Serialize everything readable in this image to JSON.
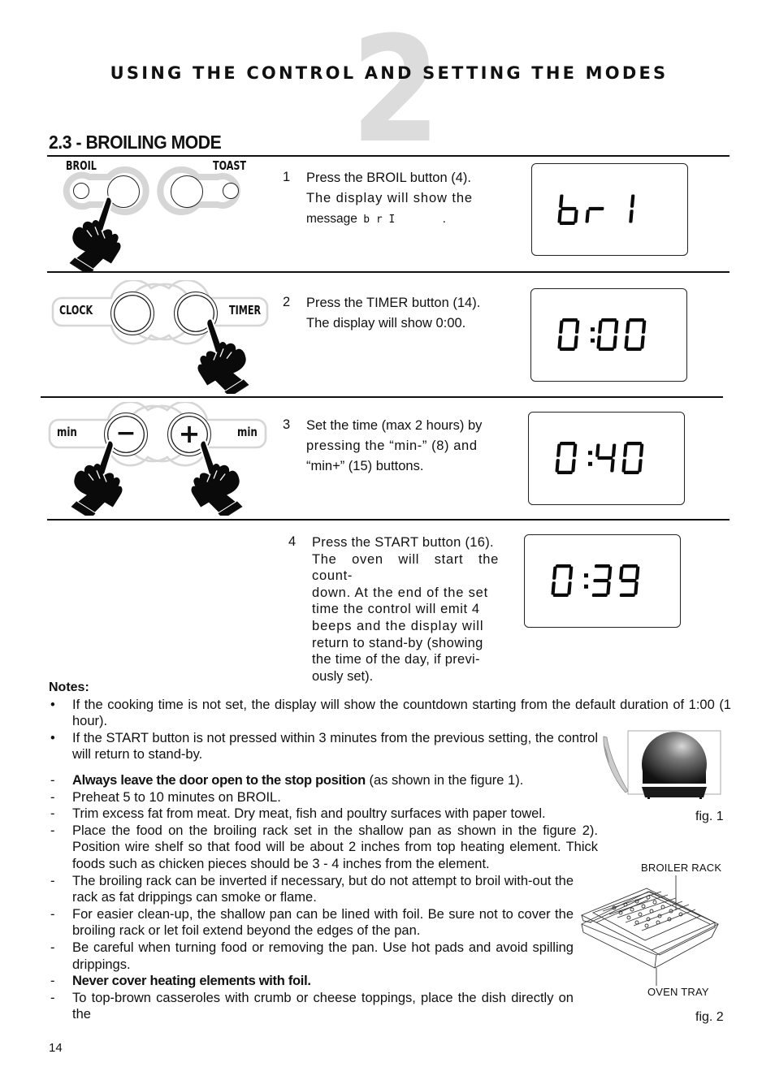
{
  "header": {
    "chapter_number": "2",
    "chapter_title": "USING THE CONTROL AND SETTING THE MODES",
    "section_title": "2.3 - BROILING MODE"
  },
  "steps": [
    {
      "number": "1",
      "text_lines": [
        "Press the BROIL button (4).",
        "The display will show the",
        "message"
      ],
      "inline_message": "b r I",
      "trailing": ".",
      "panel": {
        "left_label": "BROIL",
        "right_label": "TOAST",
        "pressed": "BROIL"
      },
      "display": "brI"
    },
    {
      "number": "2",
      "text_lines": [
        "Press the TIMER button (14).",
        "The display will show 0:00."
      ],
      "panel": {
        "left_label": "CLOCK",
        "right_label": "TIMER",
        "pressed": "TIMER"
      },
      "display": "0:00"
    },
    {
      "number": "3",
      "text_lines": [
        "Set the time (max 2 hours) by",
        "pressing the “min-” (8) and",
        "“min+” (15) buttons."
      ],
      "panel": {
        "left_label": "min",
        "right_label": "min",
        "left_symbol": "−",
        "right_symbol": "+",
        "pressed": "both"
      },
      "display": "0:40"
    },
    {
      "number": "4",
      "text_lines": [
        "Press the START button (16).",
        "The oven will start the count-",
        "down. At the end of the set",
        "time the control will emit 4",
        "beeps and the display will",
        "return to stand-by (showing",
        "the time of the day, if previ-",
        "ously set)."
      ],
      "display": "0:39"
    }
  ],
  "notes": {
    "heading": "Notes:",
    "bullets": [
      "If the cooking time is not set, the display will show the countdown starting from the default duration of 1:00 (1 hour).",
      "If the START button is not pressed within 3 minutes from the previous setting, the control will return to stand-by."
    ],
    "bullet_mark": "•",
    "dash_mark": "-",
    "dashes": [
      {
        "bold": "Always leave the door open to the stop position",
        "text": " (as shown in the figure 1)."
      },
      {
        "bold": "",
        "text": "Preheat 5 to 10 minutes on BROIL."
      },
      {
        "bold": "",
        "text": "Trim excess fat from meat. Dry meat, fish and poultry surfaces with paper towel."
      },
      {
        "bold": "",
        "text": "Place the food on the broiling rack set in the shallow pan as shown in the figure 2). Position wire shelf so that food will be about 2 inches from top heating element. Thick foods such as chicken pieces should be 3 - 4 inches from the element."
      },
      {
        "bold": "",
        "text": "The broiling rack can be inverted if necessary, but do not attempt to broil with-out the rack as fat drippings can smoke or flame."
      },
      {
        "bold": "",
        "text": "For easier clean-up, the shallow pan can be lined with foil. Be sure not to cover the broiling rack or let foil extend beyond the edges of the pan."
      },
      {
        "bold": "",
        "text": "Be careful when turning food or removing the pan. Use hot pads and avoid spilling drippings."
      },
      {
        "bold": "Never cover heating elements with foil.",
        "text": ""
      },
      {
        "bold": "",
        "text": "To top-brown casseroles with crumb or cheese toppings, place the dish directly on the"
      }
    ]
  },
  "figures": {
    "fig1_caption": "fig. 1",
    "fig2_caption": "fig. 2",
    "fig2_top_label": "BROILER RACK",
    "fig2_bottom_label": "OVEN TRAY"
  },
  "footer": {
    "page_number": "14"
  }
}
